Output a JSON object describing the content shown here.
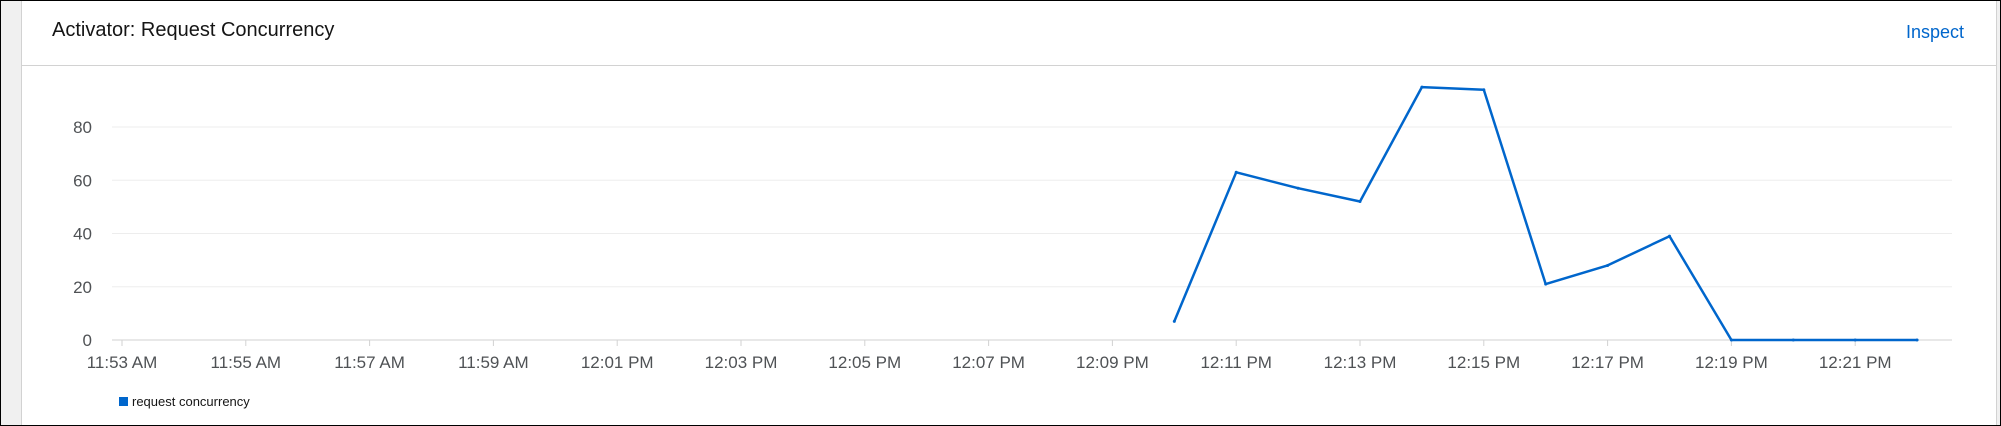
{
  "card": {
    "title": "Activator: Request Concurrency",
    "inspect_label": "Inspect"
  },
  "colors": {
    "series": "#0066cc",
    "grid": "#ededed",
    "axis": "#d2d2d2",
    "tick_text": "#4f5255"
  },
  "chart_data": {
    "type": "line",
    "title": "Activator: Request Concurrency",
    "xlabel": "",
    "ylabel": "",
    "grid": true,
    "legend_position": "bottom-left",
    "x_ticks": [
      "11:53 AM",
      "11:55 AM",
      "11:57 AM",
      "11:59 AM",
      "12:01 PM",
      "12:03 PM",
      "12:05 PM",
      "12:07 PM",
      "12:09 PM",
      "12:11 PM",
      "12:13 PM",
      "12:15 PM",
      "12:17 PM",
      "12:19 PM",
      "12:21 PM"
    ],
    "y_ticks": [
      0,
      20,
      40,
      60,
      80
    ],
    "ylim": [
      0,
      95
    ],
    "series": [
      {
        "name": "request concurrency",
        "points": [
          {
            "x": "12:10 PM",
            "y": 7
          },
          {
            "x": "12:11 PM",
            "y": 63
          },
          {
            "x": "12:12 PM",
            "y": 57
          },
          {
            "x": "12:13 PM",
            "y": 52
          },
          {
            "x": "12:14 PM",
            "y": 95
          },
          {
            "x": "12:15 PM",
            "y": 94
          },
          {
            "x": "12:16 PM",
            "y": 21
          },
          {
            "x": "12:17 PM",
            "y": 28
          },
          {
            "x": "12:18 PM",
            "y": 39
          },
          {
            "x": "12:19 PM",
            "y": 0
          },
          {
            "x": "12:20 PM",
            "y": 0
          },
          {
            "x": "12:21 PM",
            "y": 0
          },
          {
            "x": "12:22 PM",
            "y": 0
          }
        ]
      }
    ]
  }
}
